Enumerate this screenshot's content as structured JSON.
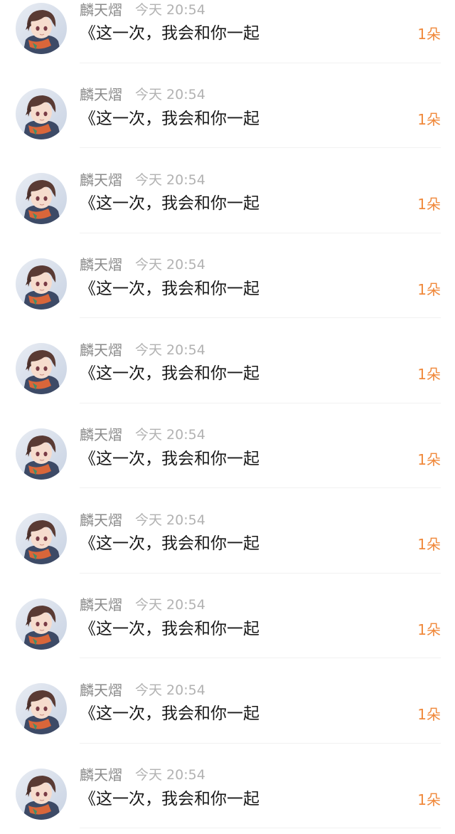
{
  "items": [
    {
      "name": "麟天熠",
      "time": "今天 20:54",
      "title": "《这一次，我会和你一起",
      "amount": "1朵"
    },
    {
      "name": "麟天熠",
      "time": "今天 20:54",
      "title": "《这一次，我会和你一起",
      "amount": "1朵"
    },
    {
      "name": "麟天熠",
      "time": "今天 20:54",
      "title": "《这一次，我会和你一起",
      "amount": "1朵"
    },
    {
      "name": "麟天熠",
      "time": "今天 20:54",
      "title": "《这一次，我会和你一起",
      "amount": "1朵"
    },
    {
      "name": "麟天熠",
      "time": "今天 20:54",
      "title": "《这一次，我会和你一起",
      "amount": "1朵"
    },
    {
      "name": "麟天熠",
      "time": "今天 20:54",
      "title": "《这一次，我会和你一起",
      "amount": "1朵"
    },
    {
      "name": "麟天熠",
      "time": "今天 20:54",
      "title": "《这一次，我会和你一起",
      "amount": "1朵"
    },
    {
      "name": "麟天熠",
      "time": "今天 20:54",
      "title": "《这一次，我会和你一起",
      "amount": "1朵"
    },
    {
      "name": "麟天熠",
      "time": "今天 20:54",
      "title": "《这一次，我会和你一起",
      "amount": "1朵"
    },
    {
      "name": "麟天熠",
      "time": "今天 20:54",
      "title": "《这一次，我会和你一起",
      "amount": "1朵"
    }
  ],
  "colors": {
    "name": "#8a8a8a",
    "time": "#b2b2b2",
    "title": "#1a1a1a",
    "amount": "#f0883a"
  },
  "icons": {
    "avatar": "anime-boy-avatar"
  }
}
